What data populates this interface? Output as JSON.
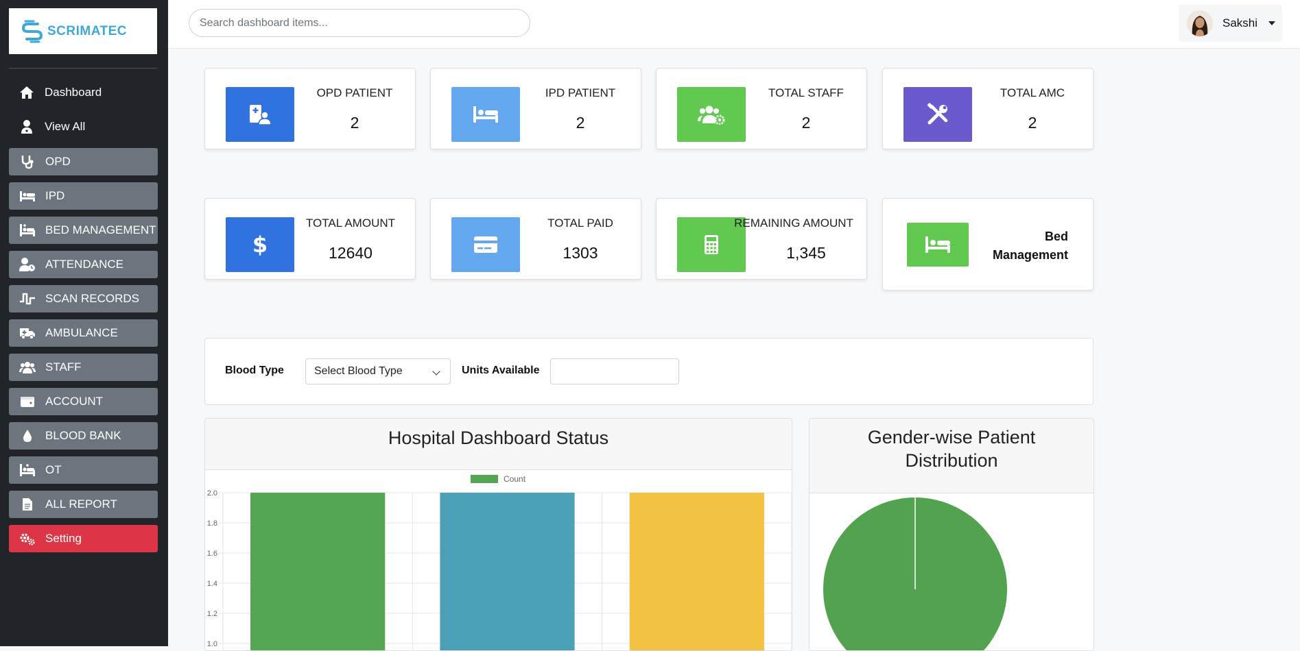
{
  "brand": {
    "name": "SCRIMATEC",
    "accent": "#3fa9d6"
  },
  "sidebar": {
    "items": [
      {
        "label": "Dashboard",
        "icon": "home-icon",
        "style": "plain"
      },
      {
        "label": "View All",
        "icon": "user-doctor-icon",
        "style": "plain"
      },
      {
        "label": "OPD",
        "icon": "stethoscope-icon",
        "style": "button"
      },
      {
        "label": "IPD",
        "icon": "bed-icon",
        "style": "button"
      },
      {
        "label": "BED MANAGEMENT",
        "icon": "hospital-bed-icon",
        "style": "button"
      },
      {
        "label": "ATTENDANCE",
        "icon": "user-clock-icon",
        "style": "button"
      },
      {
        "label": "SCAN RECORDS",
        "icon": "wave-icon",
        "style": "button"
      },
      {
        "label": "AMBULANCE",
        "icon": "ambulance-icon",
        "style": "button"
      },
      {
        "label": "STAFF",
        "icon": "users-icon",
        "style": "button"
      },
      {
        "label": "ACCOUNT",
        "icon": "wallet-icon",
        "style": "button"
      },
      {
        "label": "BLOOD BANK",
        "icon": "droplet-icon",
        "style": "button"
      },
      {
        "label": "OT",
        "icon": "procedures-icon",
        "style": "button"
      },
      {
        "label": "ALL REPORT",
        "icon": "file-icon",
        "style": "button"
      },
      {
        "label": "Setting",
        "icon": "gears-icon",
        "style": "danger"
      }
    ]
  },
  "topbar": {
    "search_placeholder": "Search dashboard items...",
    "user_name": "Sakshi"
  },
  "stats_row1": [
    {
      "label": "OPD PATIENT",
      "value": "2",
      "color": "#3073e0",
      "icon": "hospital-user-icon"
    },
    {
      "label": "IPD PATIENT",
      "value": "2",
      "color": "#63a8ee",
      "icon": "bed-icon"
    },
    {
      "label": "TOTAL STAFF",
      "value": "2",
      "color": "#61c950",
      "icon": "users-gear-icon"
    },
    {
      "label": "TOTAL AMC",
      "value": "2",
      "color": "#6a5acd",
      "icon": "tools-icon"
    }
  ],
  "stats_row2": [
    {
      "label": "TOTAL AMOUNT",
      "value": "12640",
      "color": "#3073e0",
      "icon": "dollar-icon"
    },
    {
      "label": "TOTAL PAID",
      "value": "1303",
      "color": "#63a8ee",
      "icon": "credit-card-icon"
    },
    {
      "label": "REMAINING AMOUNT",
      "value": "1,345",
      "color": "#61c950",
      "icon": "calculator-icon"
    }
  ],
  "bed_card": {
    "title": "Bed Management",
    "color": "#61c950",
    "icon": "bed-icon"
  },
  "blood": {
    "type_label": "Blood Type",
    "select_value": "Select Blood Type",
    "units_label": "Units Available",
    "units_value": ""
  },
  "chart_data": [
    {
      "type": "bar",
      "title": "Hospital Dashboard Status",
      "series": [
        {
          "name": "Count",
          "values": [
            2,
            2,
            2
          ]
        }
      ],
      "categories": [
        "",
        "",
        ""
      ],
      "bar_colors": [
        "#54a653",
        "#4aa0b6",
        "#f3c242"
      ],
      "y_ticks": [
        "2.0",
        "1.8",
        "1.6",
        "1.4",
        "1.2",
        "1.0"
      ],
      "ylim_visible": [
        1.0,
        2.0
      ],
      "grid": true,
      "legend": "top-center"
    },
    {
      "type": "pie",
      "title": "Gender-wise Patient Distribution",
      "slice_color": "#52a24f",
      "values": [
        1
      ]
    }
  ]
}
